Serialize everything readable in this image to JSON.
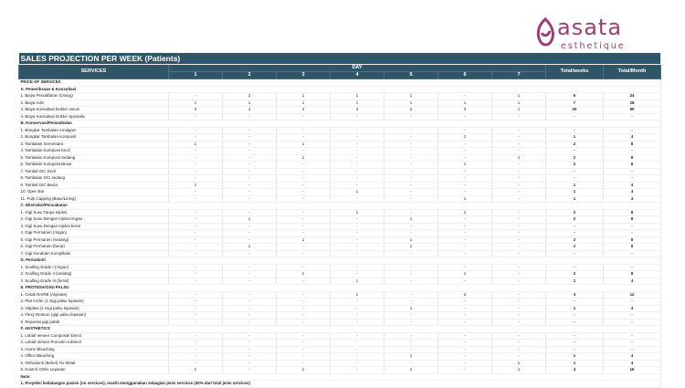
{
  "logo": {
    "word": "asata",
    "sub": "esthetique",
    "color": "#9b3f73"
  },
  "sheet": {
    "title": "SALES PROJECTION PER WEEK (Patients)",
    "services_header": "SERVICES",
    "day_header": "DAY",
    "days": [
      "1",
      "2",
      "3",
      "4",
      "5",
      "6",
      "7"
    ],
    "total_weeks": "Total/weeks",
    "total_month": "Total/Month",
    "price_header": "PRICE OF SERVICES",
    "rows": [
      {
        "kind": "sec",
        "label": "A. Pemeriksaan & Konsultasi"
      },
      {
        "label": "1. Biaya Pendaftaran (Orang)",
        "v": [
          "-",
          "2",
          "1",
          "1",
          "1",
          "-",
          "1"
        ],
        "w": "6",
        "m": "24"
      },
      {
        "label": "2. Biaya Adm",
        "v": [
          "1",
          "1",
          "1",
          "1",
          "1",
          "1",
          "1"
        ],
        "w": "7",
        "m": "28"
      },
      {
        "label": "3. Biaya Konsultasi Dokter umum",
        "v": [
          "3",
          "4",
          "4",
          "3",
          "2",
          "3",
          "1"
        ],
        "w": "20",
        "m": "80"
      },
      {
        "label": "4. Biaya Konsultasi Dokter Spesialis",
        "v": [
          "-",
          "-",
          "-",
          "-",
          "-",
          "-",
          "-"
        ],
        "w": "-",
        "m": "-"
      },
      {
        "kind": "sec",
        "label": "B. Konservasi/Penambalan"
      },
      {
        "label": "1. Bongkar Tambalan Amalgam",
        "v": [
          "-",
          "-",
          "-",
          "-",
          "-",
          "-",
          "-"
        ],
        "w": "-",
        "m": "-"
      },
      {
        "label": "2. Bongkar Tambalan Komposit",
        "v": [
          "-",
          "-",
          "-",
          "-",
          "-",
          "1",
          "-"
        ],
        "w": "1",
        "m": "4"
      },
      {
        "label": "3. Tambalan Sementara",
        "v": [
          "1",
          "-",
          "1",
          "-",
          "-",
          "-",
          "-"
        ],
        "w": "2",
        "m": "8"
      },
      {
        "label": "4. Tambalan Komposit Kecil",
        "v": [
          "-",
          "-",
          "-",
          "-",
          "-",
          "-",
          "-"
        ],
        "w": "-",
        "m": "-"
      },
      {
        "label": "5. Tambalan Komposit Sedang",
        "v": [
          "-",
          "-",
          "1",
          "-",
          "-",
          "-",
          "1"
        ],
        "w": "2",
        "m": "8"
      },
      {
        "label": "6. Tambalan Komposit Besar",
        "v": [
          "-",
          "-",
          "-",
          "-",
          "-",
          "1",
          "-"
        ],
        "w": "2",
        "m": "8"
      },
      {
        "label": "7. Tambal GIC Kecil",
        "v": [
          "-",
          "-",
          "-",
          "-",
          "-",
          "-",
          "-"
        ],
        "w": "-",
        "m": "-"
      },
      {
        "label": "8. Tambalan GIC sedang",
        "v": [
          "-",
          "-",
          "-",
          "-",
          "-",
          "-",
          "-"
        ],
        "w": "-",
        "m": "-"
      },
      {
        "label": "9. Tambal GIC Besar",
        "v": [
          "1",
          "-",
          "-",
          "-",
          "-",
          "-",
          "-"
        ],
        "w": "1",
        "m": "4"
      },
      {
        "label": "10. Open Bur",
        "v": [
          "-",
          "-",
          "-",
          "1",
          "-",
          "-",
          "-"
        ],
        "w": "1",
        "m": "4"
      },
      {
        "label": "11. Pulp Capping (Base/Lining)",
        "v": [
          "-",
          "-",
          "-",
          "-",
          "-",
          "1",
          "-"
        ],
        "w": "1",
        "m": "4"
      },
      {
        "kind": "sec",
        "label": "C. Ekstraksi/Pencabutan"
      },
      {
        "label": "1. Gigi Susu Tanpa Injeksi",
        "v": [
          "-",
          "-",
          "-",
          "1",
          "-",
          "1",
          "-"
        ],
        "w": "2",
        "m": "8"
      },
      {
        "label": "2. Gigi Susu Dengan Injeksi ringan",
        "v": [
          "-",
          "1",
          "-",
          "-",
          "1",
          "-",
          "-"
        ],
        "w": "2",
        "m": "8"
      },
      {
        "label": "3. Gigi Susu Dengan Injeksi berat",
        "v": [
          "-",
          "-",
          "-",
          "-",
          "-",
          "-",
          "-"
        ],
        "w": "-",
        "m": "-"
      },
      {
        "label": "4. Gigi Permanen (ringan)",
        "v": [
          "-",
          "-",
          "-",
          "-",
          "-",
          "-",
          "-"
        ],
        "w": "-",
        "m": "-"
      },
      {
        "label": "5. Gigi Permanen (sedang)",
        "v": [
          "-",
          "-",
          "1",
          "-",
          "1",
          "-",
          "-"
        ],
        "w": "2",
        "m": "8"
      },
      {
        "label": "6. Gigi Permanen (berat)",
        "v": [
          "-",
          "1",
          "-",
          "-",
          "1",
          "-",
          "-"
        ],
        "w": "2",
        "m": "8"
      },
      {
        "label": "7. Gigi Geraham Komplikasi",
        "v": [
          "-",
          "-",
          "-",
          "-",
          "-",
          "-",
          "-"
        ],
        "w": "-",
        "m": "-"
      },
      {
        "kind": "sec",
        "label": "D. Periodonti"
      },
      {
        "label": "1. Scalling Grade I (ringan)",
        "v": [
          "-",
          "-",
          "-",
          "-",
          "-",
          "-",
          "-"
        ],
        "w": "-",
        "m": "-"
      },
      {
        "label": "2. Scalling Grade II (sedang)",
        "v": [
          "-",
          "-",
          "1",
          "-",
          "-",
          "1",
          "-"
        ],
        "w": "2",
        "m": "8"
      },
      {
        "label": "3. Scalling Grade III (berat)",
        "v": [
          "-",
          "-",
          "-",
          "1",
          "-",
          "-",
          "-"
        ],
        "w": "1",
        "m": "4"
      },
      {
        "kind": "sec",
        "label": "E. PROTESA/GIGI PALSU"
      },
      {
        "label": "1. Cetak RA/RB (Alginate)",
        "v": [
          "-",
          "-",
          "-",
          "1",
          "-",
          "2",
          "-"
        ],
        "w": "3",
        "m": "12"
      },
      {
        "label": "2. Plat Acrilic (1 Gigi palsu lepasan)",
        "v": [
          "-",
          "-",
          "-",
          "-",
          "-",
          "-",
          "-"
        ],
        "w": "-",
        "m": "-"
      },
      {
        "label": "3. Valplast (1 Gigi palsu lepasan)",
        "v": [
          "-",
          "-",
          "-",
          "-",
          "1",
          "-",
          "-"
        ],
        "w": "1",
        "m": "4"
      },
      {
        "label": "4. Flexy Denture (gigi palsu lepasan)",
        "v": [
          "-",
          "-",
          "-",
          "-",
          "-",
          "-",
          "-"
        ],
        "w": "-",
        "m": "-"
      },
      {
        "label": "5. Reparasi gigi patah",
        "v": [
          "-",
          "-",
          "-",
          "-",
          "-",
          "-",
          "-"
        ],
        "w": "-",
        "m": "-"
      },
      {
        "kind": "sec",
        "label": "F. AESTHETICS"
      },
      {
        "label": "1. Lebial Veneer Composite Direct",
        "v": [
          "-",
          "-",
          "-",
          "-",
          "-",
          "-",
          "-"
        ],
        "w": "-",
        "m": "-"
      },
      {
        "label": "2. Lebial Veneer Porcelen InDirect",
        "v": [
          "-",
          "-",
          "-",
          "-",
          "-",
          "-",
          "-"
        ],
        "w": "-",
        "m": "-"
      },
      {
        "label": "3. Home Bleaching",
        "v": [
          "-",
          "-",
          "-",
          "-",
          "-",
          "-",
          "-"
        ],
        "w": "-",
        "m": "-"
      },
      {
        "label": "4. Office Bleaching",
        "v": [
          "-",
          "-",
          "-",
          "-",
          "1",
          "-",
          "-"
        ],
        "w": "1",
        "m": "4"
      },
      {
        "label": "5. Orthodonti (Behel) Fix Metal",
        "v": [
          "-",
          "-",
          "-",
          "-",
          "-",
          "-",
          "1"
        ],
        "w": "1",
        "m": "4"
      },
      {
        "label": "6. Kontrol Ortho Lepasan",
        "v": [
          "1",
          "-",
          "1",
          "-",
          "1",
          "-",
          "1"
        ],
        "w": "4",
        "m": "16"
      }
    ],
    "note_label": "Note:",
    "note_text": "1. Proyeksi kedatangan pasien (on services), masih menggunakan sebagian jenis services (40% dari total jenis services)"
  }
}
